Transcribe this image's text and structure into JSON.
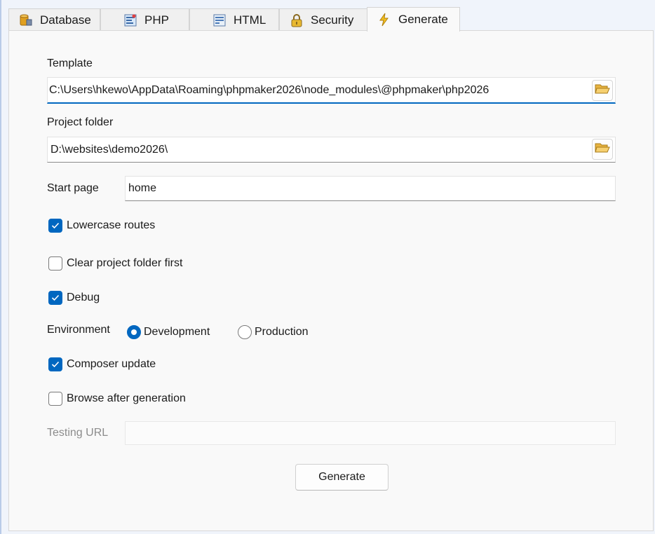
{
  "tabs": [
    {
      "label": "Database",
      "icon": "database-icon"
    },
    {
      "label": "PHP",
      "icon": "php-file-icon"
    },
    {
      "label": "HTML",
      "icon": "html-file-icon"
    },
    {
      "label": "Security",
      "icon": "lock-icon"
    },
    {
      "label": "Generate",
      "icon": "lightning-icon",
      "active": true
    }
  ],
  "form": {
    "template_label": "Template",
    "template_value": "C:\\Users\\hkewo\\AppData\\Roaming\\phpmaker2026\\node_modules\\@phpmaker\\php2026",
    "project_folder_label": "Project folder",
    "project_folder_value": "D:\\websites\\demo2026\\",
    "start_page_label": "Start page",
    "start_page_value": "home",
    "lowercase_routes_label": "Lowercase routes",
    "lowercase_routes_checked": true,
    "clear_project_label": "Clear project folder first",
    "clear_project_checked": false,
    "debug_label": "Debug",
    "debug_checked": true,
    "environment_label": "Environment",
    "environment_options": [
      "Development",
      "Production"
    ],
    "environment_selected": "Development",
    "composer_update_label": "Composer update",
    "composer_update_checked": true,
    "browse_after_label": "Browse after generation",
    "browse_after_checked": false,
    "testing_url_label": "Testing URL",
    "testing_url_value": "",
    "generate_button_label": "Generate"
  },
  "colors": {
    "accent": "#0067c0",
    "panel_bg": "#f9f9f9",
    "window_bg": "#f0f4fb"
  }
}
